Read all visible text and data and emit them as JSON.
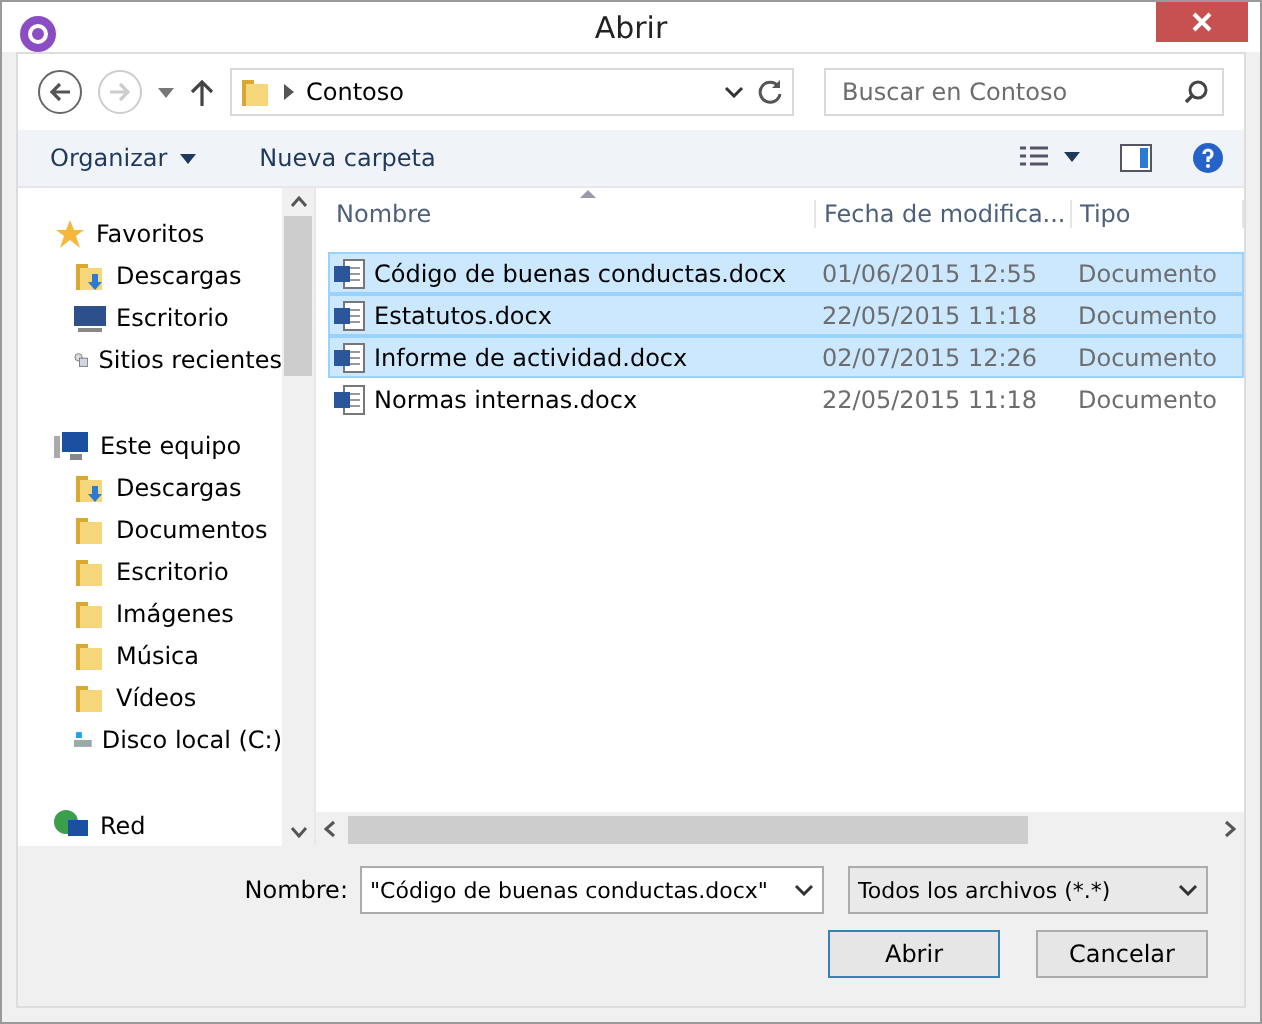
{
  "window": {
    "title": "Abrir"
  },
  "nav": {
    "path": "Contoso",
    "search_placeholder": "Buscar en Contoso"
  },
  "toolbar": {
    "organize": "Organizar",
    "new_folder": "Nueva carpeta"
  },
  "sidebar": {
    "groups": [
      {
        "label": "Favoritos",
        "kind": "star",
        "children": [
          {
            "label": "Descargas",
            "kind": "downloads"
          },
          {
            "label": "Escritorio",
            "kind": "desktop"
          },
          {
            "label": "Sitios recientes",
            "kind": "recent"
          }
        ]
      },
      {
        "label": "Este equipo",
        "kind": "computer",
        "children": [
          {
            "label": "Descargas",
            "kind": "downloads"
          },
          {
            "label": "Documentos",
            "kind": "folder"
          },
          {
            "label": "Escritorio",
            "kind": "folder"
          },
          {
            "label": "Imágenes",
            "kind": "folder"
          },
          {
            "label": "Música",
            "kind": "folder"
          },
          {
            "label": "Vídeos",
            "kind": "folder"
          },
          {
            "label": "Disco local (C:)",
            "kind": "drive"
          }
        ]
      },
      {
        "label": "Red",
        "kind": "network"
      }
    ]
  },
  "table": {
    "columns": [
      "Nombre",
      "Fecha de modifica...",
      "Tipo"
    ],
    "rows": [
      {
        "name": "Código de buenas conductas.docx",
        "date": "01/06/2015 12:55",
        "type": "Documento",
        "selected": true
      },
      {
        "name": "Estatutos.docx",
        "date": "22/05/2015 11:18",
        "type": "Documento",
        "selected": true
      },
      {
        "name": "Informe de actividad.docx",
        "date": "02/07/2015 12:26",
        "type": "Documento",
        "selected": true
      },
      {
        "name": "Normas internas.docx",
        "date": "22/05/2015 11:18",
        "type": "Documento",
        "selected": false
      }
    ]
  },
  "footer": {
    "name_label": "Nombre:",
    "name_value": "\"Código de buenas conductas.docx\"",
    "filter": "Todos los archivos (*.*)",
    "buttons": [
      "Abrir",
      "Cancelar"
    ]
  }
}
